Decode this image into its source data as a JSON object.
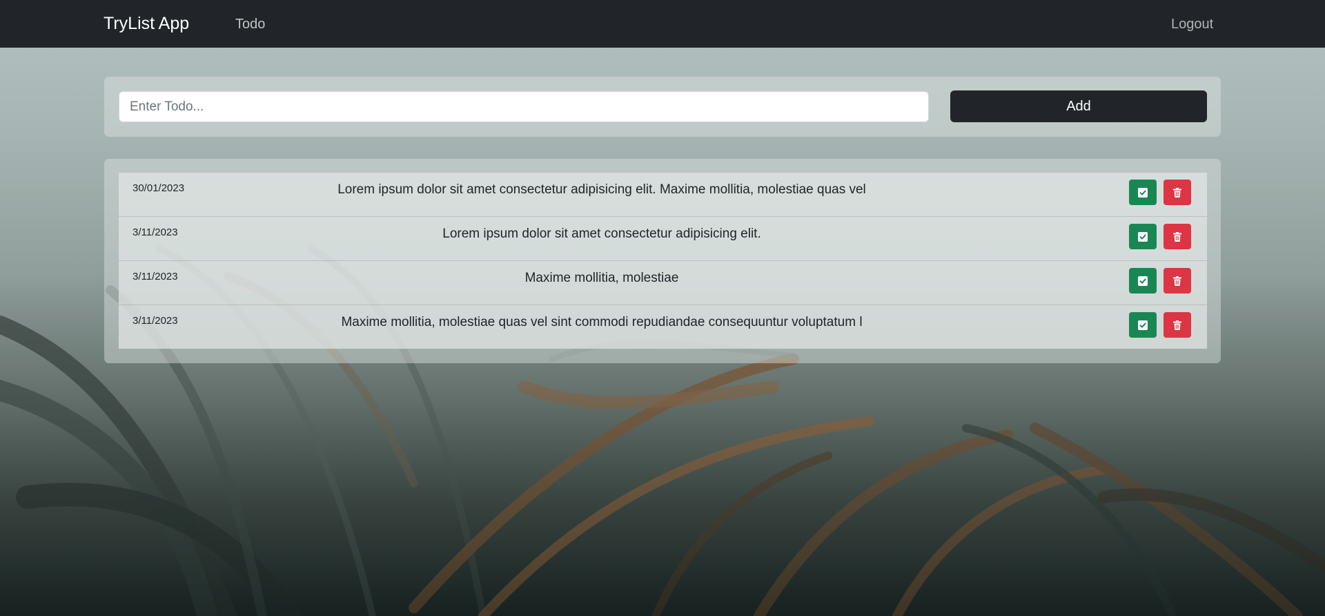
{
  "navbar": {
    "brand": "TryList App",
    "links": [
      {
        "label": "Todo"
      }
    ],
    "logout_label": "Logout"
  },
  "form": {
    "placeholder": "Enter Todo...",
    "value": "",
    "add_label": "Add"
  },
  "todos": [
    {
      "date": "30/01/2023",
      "text": "Lorem ipsum dolor sit amet consectetur adipisicing elit. Maxime mollitia, molestiae quas vel"
    },
    {
      "date": "3/11/2023",
      "text": "Lorem ipsum dolor sit amet consectetur adipisicing elit."
    },
    {
      "date": "3/11/2023",
      "text": "Maxime mollitia, molestiae"
    },
    {
      "date": "3/11/2023",
      "text": "Maxime mollitia, molestiae quas vel sint commodi repudiandae consequuntur voluptatum l"
    }
  ],
  "icons": {
    "done": "check-square-icon",
    "delete": "trash-icon"
  },
  "colors": {
    "navbar": "#212529",
    "add_button": "#212529",
    "done_button": "#198754",
    "delete_button": "#dc3545"
  }
}
